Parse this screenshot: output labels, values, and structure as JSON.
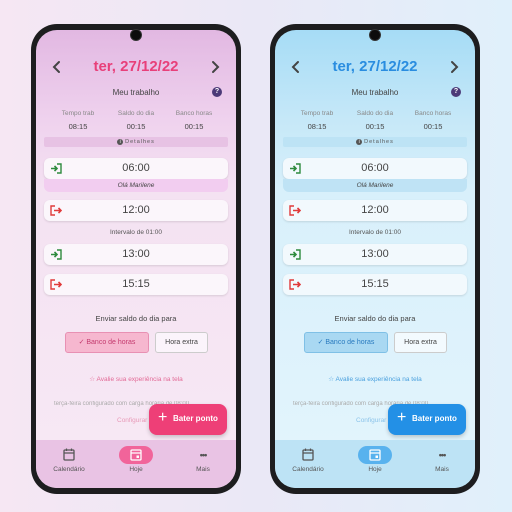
{
  "screens": [
    {
      "theme": "pink",
      "accent": "#ee3f77",
      "header": {
        "prev_icon": "chevron-left-icon",
        "date": "ter, 27/12/22",
        "next_icon": "chevron-right-icon"
      },
      "summary": {
        "title": "Meu trabalho",
        "help": "?",
        "stats": [
          {
            "label": "Tempo trab",
            "value": "08:15"
          },
          {
            "label": "Saldo do dia",
            "value": "00:15"
          },
          {
            "label": "Banco horas",
            "value": "00:15"
          }
        ],
        "details": "Detalhes",
        "details_icon": "i"
      },
      "punches": [
        {
          "type": "entrada",
          "icon": "login-icon",
          "time": "06:00"
        },
        {
          "type": "saída",
          "icon": "logout-icon",
          "time": "12:00"
        },
        {
          "type": "entrada",
          "icon": "login-icon",
          "time": "13:00"
        },
        {
          "type": "saída",
          "icon": "logout-icon",
          "time": "15:15"
        }
      ],
      "note": "Olá Marilene",
      "interval": "Intervalo de 01:00",
      "balance": {
        "title": "Enviar saldo do dia para",
        "options": [
          {
            "label": "Banco de horas",
            "selected": true
          },
          {
            "label": "Hora extra",
            "selected": false
          }
        ]
      },
      "rate": {
        "icon": "star-icon",
        "label": "Avalie sua experiência na tela"
      },
      "config_text": "terça-feira configurado com carga horária de 08:00",
      "config_link": "Configurar",
      "fab": {
        "plus": "+",
        "label": "Bater ponto"
      },
      "nav": [
        {
          "label": "Calendário",
          "icon": "calendar-icon",
          "active": false
        },
        {
          "label": "Hoje",
          "icon": "calendar-today-icon",
          "active": true
        },
        {
          "label": "Mais",
          "icon": "more-icon",
          "glyph": "•••",
          "active": false
        }
      ]
    },
    {
      "theme": "blue",
      "accent": "#2390e6",
      "header": {
        "prev_icon": "chevron-left-icon",
        "date": "ter, 27/12/22",
        "next_icon": "chevron-right-icon"
      },
      "summary": {
        "title": "Meu trabalho",
        "help": "?",
        "stats": [
          {
            "label": "Tempo trab",
            "value": "08:15"
          },
          {
            "label": "Saldo do dia",
            "value": "00:15"
          },
          {
            "label": "Banco horas",
            "value": "00:15"
          }
        ],
        "details": "Detalhes",
        "details_icon": "i"
      },
      "punches": [
        {
          "type": "entrada",
          "icon": "login-icon",
          "time": "06:00"
        },
        {
          "type": "saída",
          "icon": "logout-icon",
          "time": "12:00"
        },
        {
          "type": "entrada",
          "icon": "login-icon",
          "time": "13:00"
        },
        {
          "type": "saída",
          "icon": "logout-icon",
          "time": "15:15"
        }
      ],
      "note": "Olá Marilene",
      "interval": "Intervalo de 01:00",
      "balance": {
        "title": "Enviar saldo do dia para",
        "options": [
          {
            "label": "Banco de horas",
            "selected": true
          },
          {
            "label": "Hora extra",
            "selected": false
          }
        ]
      },
      "rate": {
        "icon": "star-icon",
        "label": "Avalie sua experiência na tela"
      },
      "config_text": "terça-feira configurado com carga horária de 08:00",
      "config_link": "Configurar",
      "fab": {
        "plus": "+",
        "label": "Bater ponto"
      },
      "nav": [
        {
          "label": "Calendário",
          "icon": "calendar-icon",
          "active": false
        },
        {
          "label": "Hoje",
          "icon": "calendar-today-icon",
          "active": true
        },
        {
          "label": "Mais",
          "icon": "more-icon",
          "glyph": "•••",
          "active": false
        }
      ]
    }
  ]
}
